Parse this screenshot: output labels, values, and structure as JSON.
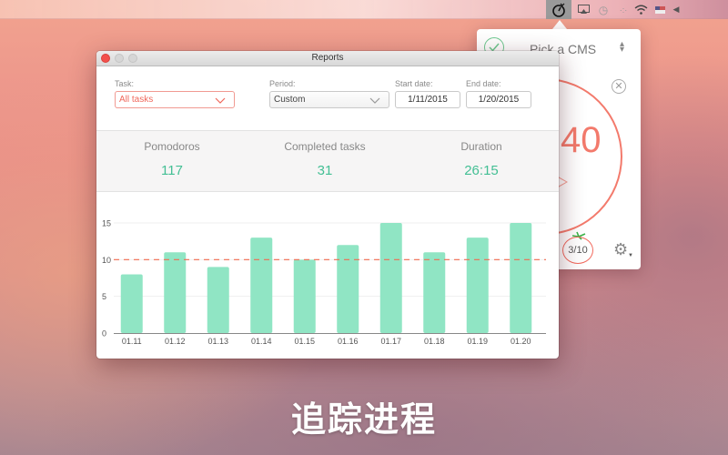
{
  "menubar": {
    "icons": [
      "pomodoro-timer-icon",
      "airplay-icon",
      "time-machine-icon",
      "bluetooth-dots-icon",
      "wifi-icon",
      "input-flag-icon",
      "volume-icon"
    ]
  },
  "popover": {
    "task_select": "Pick a CMS",
    "timer_text": "40",
    "pomodoro_count": "3/10"
  },
  "window": {
    "title": "Reports",
    "filters": {
      "task_label": "Task:",
      "task_value": "All tasks",
      "period_label": "Period:",
      "period_value": "Custom",
      "start_label": "Start date:",
      "start_value": "1/11/2015",
      "end_label": "End date:",
      "end_value": "1/20/2015"
    },
    "stats": [
      {
        "label": "Pomodoros",
        "value": "117"
      },
      {
        "label": "Completed tasks",
        "value": "31"
      },
      {
        "label": "Duration",
        "value": "26:15"
      }
    ]
  },
  "colors": {
    "bar": "#90e5c4",
    "average_line": "#f26b4f",
    "accent_green": "#43bf94",
    "accent_red": "#f0685c"
  },
  "chart_data": {
    "type": "bar",
    "title": "",
    "xlabel": "",
    "ylabel": "",
    "categories": [
      "01.11",
      "01.12",
      "01.13",
      "01.14",
      "01.15",
      "01.16",
      "01.17",
      "01.18",
      "01.19",
      "01.20"
    ],
    "values": [
      8,
      11,
      9,
      13,
      10,
      12,
      15,
      11,
      13,
      15
    ],
    "ylim": [
      0,
      15
    ],
    "yticks": [
      0,
      5,
      10,
      15
    ],
    "reference_line": {
      "value": 10,
      "style": "dashed"
    },
    "grid": true,
    "legend": "none"
  },
  "caption": "追踪进程"
}
